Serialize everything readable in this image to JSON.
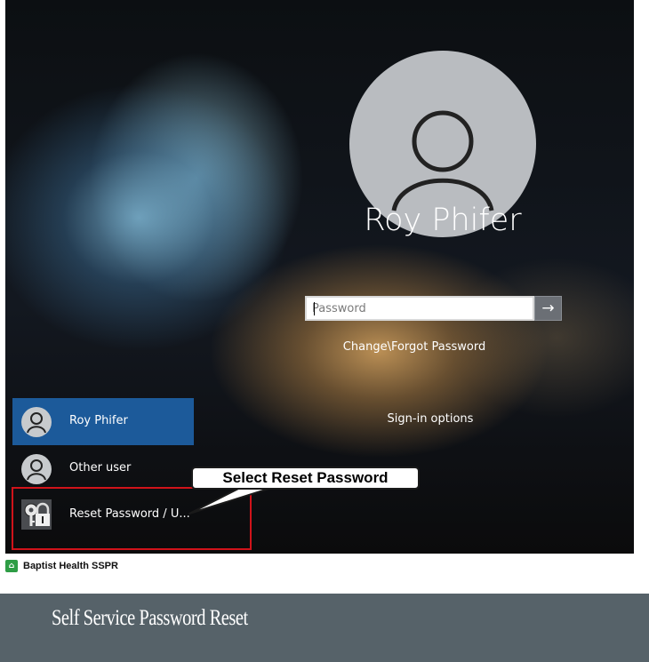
{
  "lockscreen": {
    "username": "Roy Phifer",
    "password_placeholder": "Password",
    "submit_icon": "arrow-right-icon",
    "submit_glyph": "→",
    "forgot_link": "Change\\Forgot Password",
    "signin_options": "Sign-in options"
  },
  "user_list": {
    "items": [
      {
        "label": "Roy Phifer",
        "icon": "user-avatar-icon",
        "selected": true
      },
      {
        "label": "Other user",
        "icon": "user-avatar-icon",
        "selected": false
      },
      {
        "label": "Reset Password / U...",
        "icon": "lock-keys-icon",
        "selected": false
      }
    ]
  },
  "annotation": {
    "callout_text": "Select Reset Password",
    "highlight_color": "#d0131a"
  },
  "app": {
    "title": "Baptist Health SSPR",
    "logo_icon": "baptist-health-logo-icon",
    "brand_color": "#2e9d45"
  },
  "banner": {
    "title": "Self Service Password Reset",
    "background": "#566269"
  }
}
